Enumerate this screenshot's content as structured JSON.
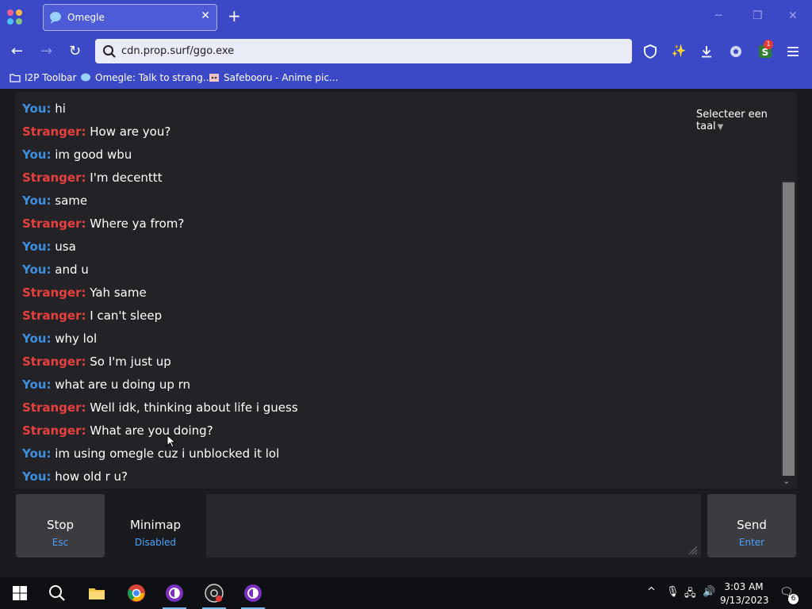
{
  "browser": {
    "tab_title": "Omegle",
    "url": "cdn.prop.surf/ggo.exe",
    "bookmarks": [
      {
        "label": "I2P Toolbar"
      },
      {
        "label": "Omegle: Talk to strang..."
      },
      {
        "label": "Safebooru - Anime pic..."
      }
    ],
    "extension_badge": "1",
    "accent_color": "#3b49c6"
  },
  "chat": {
    "language_select": "Selecteer een taal",
    "messages": [
      {
        "sender": "You:",
        "role": "you",
        "text": "hi"
      },
      {
        "sender": "Stranger:",
        "role": "stranger",
        "text": "How are you?"
      },
      {
        "sender": "You:",
        "role": "you",
        "text": "im good wbu"
      },
      {
        "sender": "Stranger:",
        "role": "stranger",
        "text": "I'm decenttt"
      },
      {
        "sender": "You:",
        "role": "you",
        "text": "same"
      },
      {
        "sender": "Stranger:",
        "role": "stranger",
        "text": "Where ya from?"
      },
      {
        "sender": "You:",
        "role": "you",
        "text": "usa"
      },
      {
        "sender": "You:",
        "role": "you",
        "text": "and u"
      },
      {
        "sender": "Stranger:",
        "role": "stranger",
        "text": "Yah same"
      },
      {
        "sender": "Stranger:",
        "role": "stranger",
        "text": "I can't sleep"
      },
      {
        "sender": "You:",
        "role": "you",
        "text": "why lol"
      },
      {
        "sender": "Stranger:",
        "role": "stranger",
        "text": "So I'm just up"
      },
      {
        "sender": "You:",
        "role": "you",
        "text": "what are u doing up rn"
      },
      {
        "sender": "Stranger:",
        "role": "stranger",
        "text": "Well idk, thinking about life i guess"
      },
      {
        "sender": "Stranger:",
        "role": "stranger",
        "text": "What are you doing?"
      },
      {
        "sender": "You:",
        "role": "you",
        "text": "im using omegle cuz i unblocked it lol"
      },
      {
        "sender": "You:",
        "role": "you",
        "text": "how old r u?"
      }
    ],
    "you_color": "#3d8fe0",
    "stranger_color": "#e8403f"
  },
  "controls": {
    "stop": {
      "label": "Stop",
      "shortcut": "Esc"
    },
    "minimap": {
      "label": "Minimap",
      "status": "Disabled"
    },
    "send": {
      "label": "Send",
      "shortcut": "Enter"
    },
    "input_value": ""
  },
  "taskbar": {
    "time": "3:03 AM",
    "date": "9/13/2023",
    "notification_count": "6"
  }
}
